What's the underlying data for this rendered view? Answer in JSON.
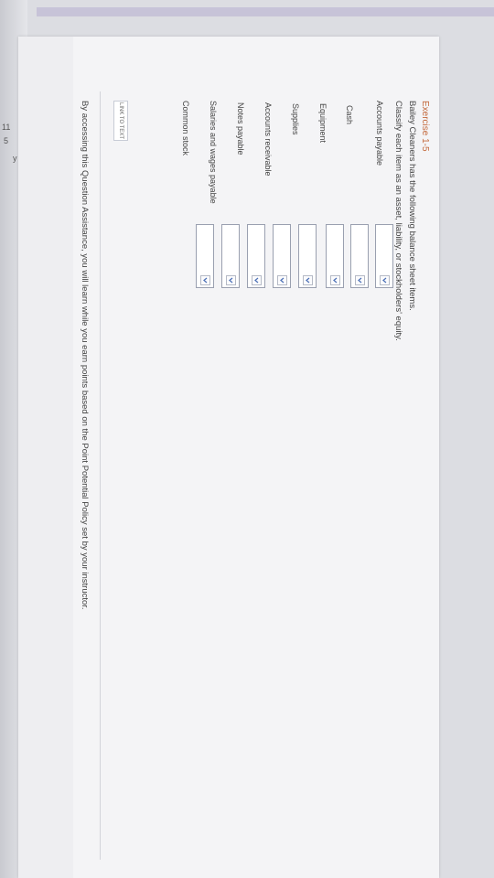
{
  "exercise": {
    "title": "Exercise 1-5",
    "intro": "Bailey Cleaners has the following balance sheet items.",
    "instruction": "Classify each item as an asset, liability, or stockholders' equity."
  },
  "items": [
    {
      "label": "Accounts payable",
      "selected": ""
    },
    {
      "label": "Cash",
      "selected": ""
    },
    {
      "label": "Equipment",
      "selected": ""
    },
    {
      "label": "Supplies",
      "selected": ""
    },
    {
      "label": "Accounts receivable",
      "selected": ""
    },
    {
      "label": "Notes payable",
      "selected": ""
    },
    {
      "label": "Salaries and wages payable",
      "selected": ""
    },
    {
      "label": "Common stock",
      "selected": ""
    }
  ],
  "link_to_text": "LINK TO TEXT",
  "assistance_note": "By accessing this Question Assistance, you will learn while you earn points based on the Point Potential Policy set by your instructor.",
  "edge_glyphs": [
    "11",
    "5",
    "y"
  ],
  "colors": {
    "title": "#c46a3d",
    "accent_bar": "#c7c3d8"
  }
}
